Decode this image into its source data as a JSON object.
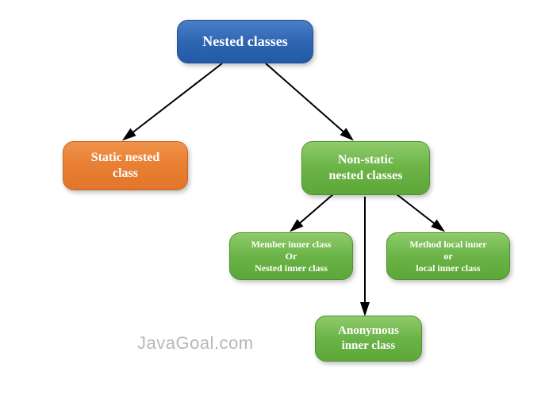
{
  "root": {
    "label": "Nested classes"
  },
  "static_nested": {
    "label": "Static nested\nclass"
  },
  "non_static": {
    "label": "Non-static\nnested classes"
  },
  "member_inner": {
    "label": "Member inner class\nOr\nNested inner class"
  },
  "method_local": {
    "label": "Method local inner\nor\nlocal inner class"
  },
  "anonymous": {
    "label": "Anonymous\ninner class"
  },
  "watermark": "JavaGoal.com",
  "colors": {
    "blue": "#2f66b3",
    "orange": "#e87f33",
    "green": "#6bb347"
  }
}
